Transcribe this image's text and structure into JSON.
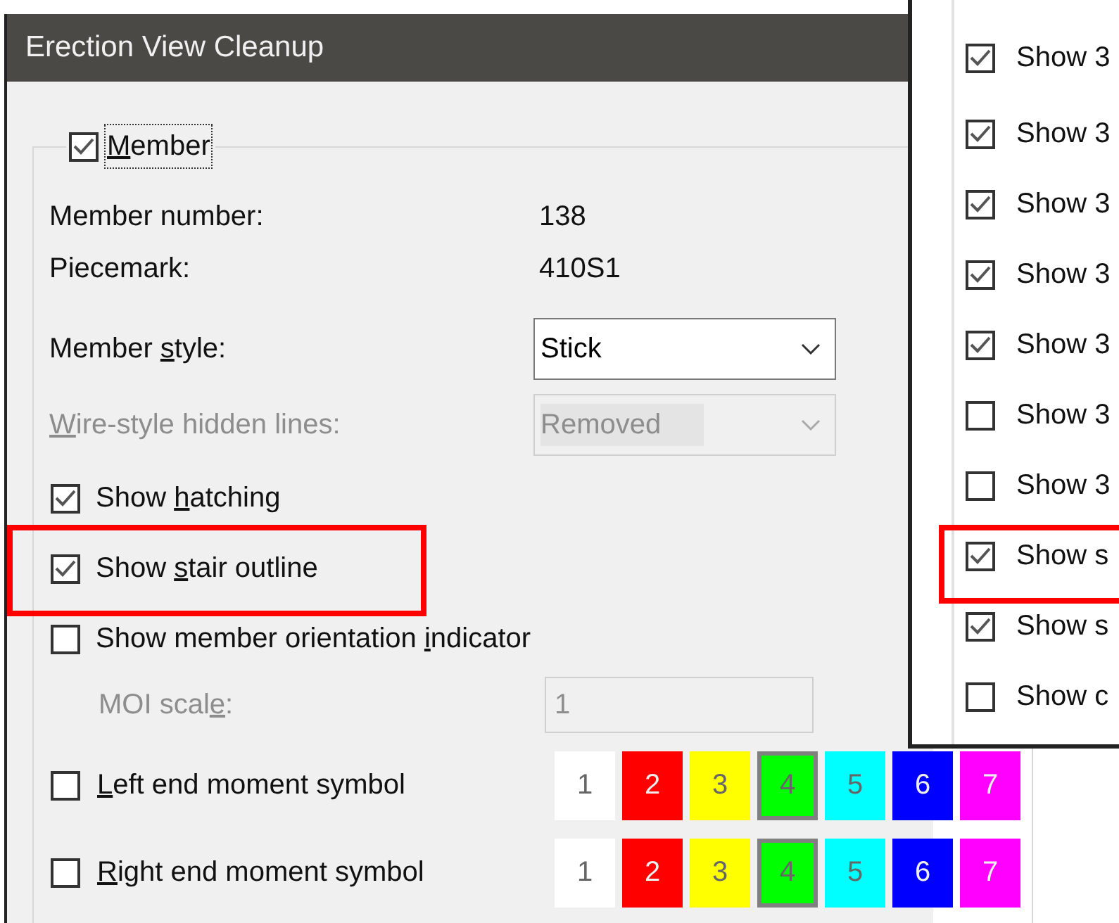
{
  "window": {
    "title": "Erection View Cleanup"
  },
  "member_group": {
    "mnemonic": "M",
    "label_post": "ember",
    "checked": true
  },
  "info": [
    {
      "label": "Member number:",
      "value": "138"
    },
    {
      "label": "Piecemark:",
      "value": "410S1"
    }
  ],
  "selects": [
    {
      "label_pre": "Member ",
      "mnemonic": "s",
      "label_post": "tyle:",
      "value": "Stick",
      "disabled": false
    },
    {
      "mnemonic": "W",
      "label_post": "ire-style hidden lines:",
      "value": "Removed",
      "disabled": true
    }
  ],
  "options": [
    {
      "label_pre": "Show ",
      "mnemonic": "h",
      "label_post": "atching",
      "checked": true
    },
    {
      "label_pre": "Show ",
      "mnemonic": "s",
      "label_post": "tair outline",
      "checked": true
    },
    {
      "label_pre": "Show member orientation ",
      "mnemonic": "i",
      "label_post": "ndicator",
      "checked": false
    }
  ],
  "moi_scale": {
    "label_pre": "MOI scal",
    "mnemonic": "e",
    "label_post": ":",
    "value": "1",
    "disabled": true
  },
  "moment_symbols": [
    {
      "mnemonic": "L",
      "label_post": "eft end moment symbol",
      "checked": false,
      "swatches": [
        {
          "label": "1",
          "color": "#ffffff",
          "selected": false
        },
        {
          "label": "2",
          "color": "#ff0000",
          "selected": false
        },
        {
          "label": "3",
          "color": "#ffff00",
          "selected": false
        },
        {
          "label": "4",
          "color": "#00ff00",
          "selected": true
        },
        {
          "label": "5",
          "color": "#00ffff",
          "selected": false
        },
        {
          "label": "6",
          "color": "#0000ff",
          "selected": false
        },
        {
          "label": "7",
          "color": "#ff00ff",
          "selected": false
        }
      ]
    },
    {
      "mnemonic": "R",
      "label_post": "ight end moment symbol",
      "checked": false,
      "swatches": [
        {
          "label": "1",
          "color": "#ffffff",
          "selected": false
        },
        {
          "label": "2",
          "color": "#ff0000",
          "selected": false
        },
        {
          "label": "3",
          "color": "#ffff00",
          "selected": false
        },
        {
          "label": "4",
          "color": "#00ff00",
          "selected": true
        },
        {
          "label": "5",
          "color": "#00ffff",
          "selected": false
        },
        {
          "label": "6",
          "color": "#0000ff",
          "selected": false
        },
        {
          "label": "7",
          "color": "#ff00ff",
          "selected": false
        }
      ]
    }
  ],
  "side_panel": {
    "items": [
      {
        "label": "Show 3",
        "checked": true
      },
      {
        "label": "Show 3",
        "checked": true
      },
      {
        "label": "Show 3",
        "checked": true
      },
      {
        "label": "Show 3",
        "checked": true
      },
      {
        "label": "Show 3",
        "checked": true
      },
      {
        "label": "Show 3",
        "checked": false
      },
      {
        "label": "Show 3",
        "checked": false
      },
      {
        "label": "Show s",
        "checked": true
      },
      {
        "label": "Show s",
        "checked": true
      },
      {
        "label": "Show c",
        "checked": false
      }
    ]
  }
}
